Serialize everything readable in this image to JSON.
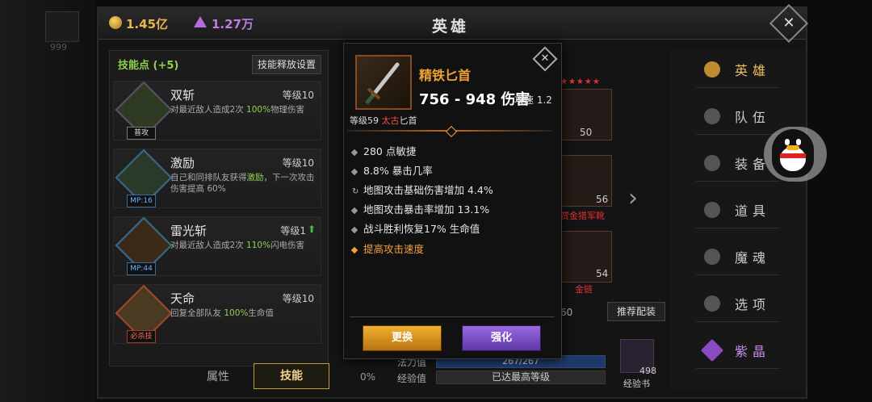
{
  "currency": {
    "gold": "1.45亿",
    "gems": "1.27万"
  },
  "window_title": "英雄",
  "left_deco_text": "999",
  "skills_panel": {
    "points_label": "技能点 (+5)",
    "release_settings": "技能释放设置",
    "skills": [
      {
        "name": "双斩",
        "level": "等级10",
        "desc_pre": "对最近敌人造成2次 ",
        "desc_hl": "100%",
        "desc_post": "物理伤害",
        "tag": "普攻"
      },
      {
        "name": "激励",
        "level": "等级10",
        "desc_pre": "自己和同排队友获得",
        "desc_hl": "激励",
        "desc_post": "，下一次攻击伤害提高 60%",
        "tag": "MP:16"
      },
      {
        "name": "雷光斩",
        "level": "等级1",
        "desc_pre": "对最近敌人造成2次 ",
        "desc_hl": "110%",
        "desc_post": "闪电伤害",
        "tag": "MP:44"
      },
      {
        "name": "天命",
        "level": "等级10",
        "desc_pre": "回复全部队友 ",
        "desc_hl": "100%",
        "desc_post": "生命值",
        "tag": "必杀技"
      }
    ],
    "tabs": {
      "attributes": "属性",
      "skills": "技能"
    }
  },
  "background_equipment": {
    "slot_values": [
      "50",
      "56",
      "54"
    ],
    "boots_label": "赏金猎军靴",
    "necklace_label": "金链",
    "recommend_button": "推荐配装",
    "percent": "0%",
    "mana_label": "法力值",
    "mana_value": "267/267",
    "exp_label": "经验值",
    "exp_value": "已达最高等级",
    "exp_book_count": "498",
    "exp_book_label": "经验书",
    "number_60": "60"
  },
  "right_nav": [
    {
      "label": "英雄",
      "icon": "heroes-icon"
    },
    {
      "label": "队伍",
      "icon": "flag-icon"
    },
    {
      "label": "装备",
      "icon": "helmet-icon"
    },
    {
      "label": "道具",
      "icon": "bag-icon"
    },
    {
      "label": "魔魂",
      "icon": "flame-icon"
    },
    {
      "label": "选项",
      "icon": "gear-icon"
    },
    {
      "label": "紫晶",
      "icon": "amethyst-icon"
    }
  ],
  "item_popup": {
    "name": "精铁匕首",
    "damage": "756 - 948 伤害",
    "speed": "攻速 1.2",
    "sub_level": "等级59 ",
    "sub_ancient": "太古",
    "sub_type": "匕首",
    "stats": [
      "280 点敏捷",
      "8.8% 暴击几率",
      "地图攻击基础伤害增加 4.4%",
      "地图攻击暴击率增加 13.1%",
      "战斗胜利恢复17% 生命值"
    ],
    "special_stat": "提高攻击速度",
    "replace_button": "更换",
    "enhance_button": "强化",
    "colors": {
      "item_name": "#f2a233",
      "ancient": "#ff4a3a",
      "special": "#f0a040"
    }
  }
}
